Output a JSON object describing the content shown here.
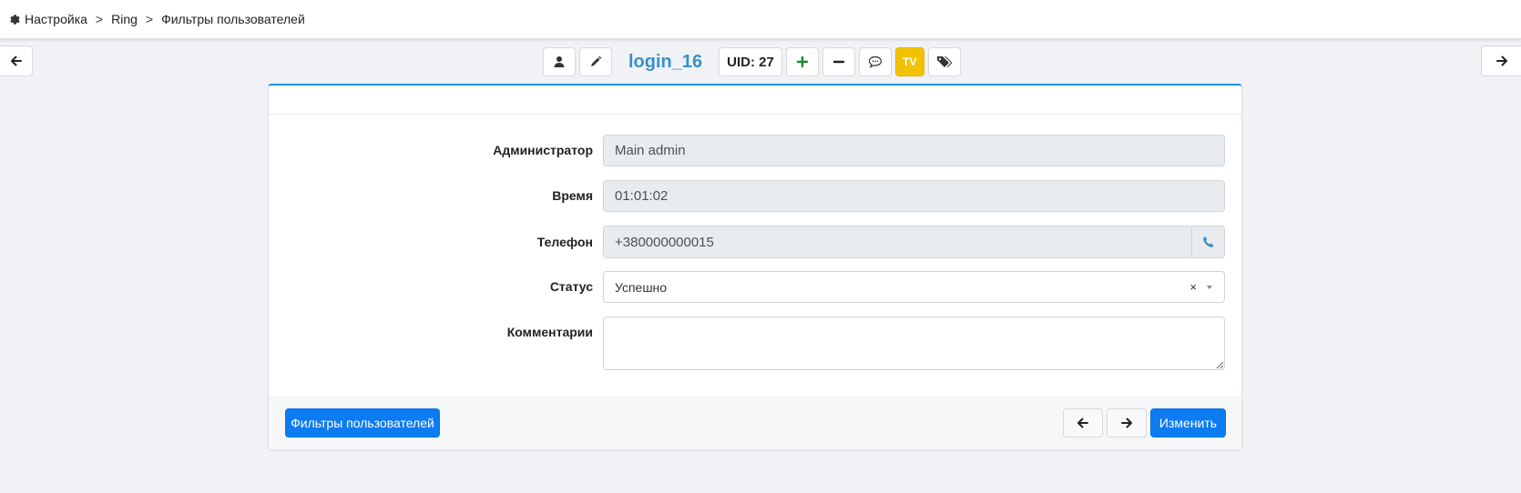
{
  "breadcrumb": {
    "items": [
      "Настройка",
      "Ring",
      "Фильтры пользователей"
    ],
    "separator": ">"
  },
  "toolbar": {
    "login": "login_16",
    "uid": "UID: 27",
    "tv_label": "TV",
    "icons": [
      "user-icon",
      "pencil-icon",
      "plus-icon",
      "minus-icon",
      "comment-icon",
      "tags-icon"
    ]
  },
  "form": {
    "admin_label": "Администратор",
    "admin_value": "Main admin",
    "time_label": "Время",
    "time_value": "01:01:02",
    "phone_label": "Телефон",
    "phone_value": "+380000000015",
    "status_label": "Статус",
    "status_value": "Успешно",
    "status_clear": "×",
    "comment_label": "Комментарии",
    "comment_value": ""
  },
  "footer": {
    "back_button": "Фильтры пользователей",
    "submit_button": "Изменить"
  },
  "colors": {
    "accent": "#0d7cf2",
    "login": "#3a8fc7",
    "tv": "#f2c200",
    "plus": "#1a8a2a"
  }
}
